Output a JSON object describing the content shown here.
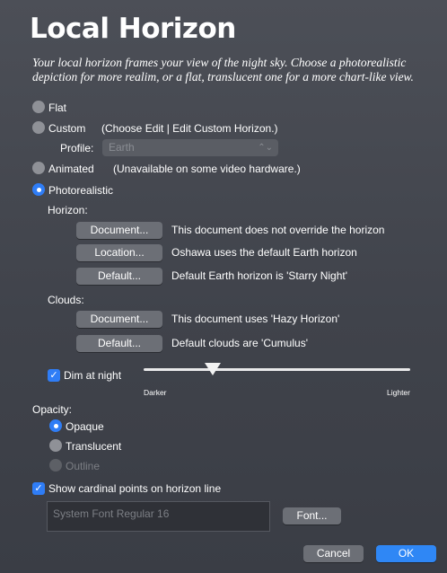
{
  "title": "Local Horizon",
  "subtitle": "Your local horizon frames your view of the night sky. Choose a photorealistic depiction for more realim, or a flat, translucent one for a more chart-like view.",
  "modes": {
    "flat": "Flat",
    "custom": "Custom",
    "custom_hint": "(Choose Edit | Edit Custom Horizon.)",
    "profile_label": "Profile:",
    "profile_value": "Earth",
    "animated": "Animated",
    "animated_hint": "(Unavailable on some video hardware.)",
    "photorealistic": "Photorealistic",
    "selected": "photorealistic"
  },
  "horizon": {
    "heading": "Horizon:",
    "rows": [
      {
        "button": "Document...",
        "text": "This document does not override the horizon"
      },
      {
        "button": "Location...",
        "text": "Oshawa uses the default Earth horizon"
      },
      {
        "button": "Default...",
        "text": "Default Earth horizon is 'Starry Night'"
      }
    ]
  },
  "clouds": {
    "heading": "Clouds:",
    "rows": [
      {
        "button": "Document...",
        "text": "This document uses 'Hazy Horizon'"
      },
      {
        "button": "Default...",
        "text": "Default clouds are 'Cumulus'"
      }
    ]
  },
  "dim": {
    "label": "Dim at night",
    "checked": true,
    "min_label": "Darker",
    "max_label": "Lighter",
    "level": 0.26
  },
  "opacity": {
    "heading": "Opacity:",
    "opaque": "Opaque",
    "translucent": "Translucent",
    "outline": "Outline",
    "selected": "opaque"
  },
  "cardinal": {
    "label": "Show cardinal points on horizon line",
    "checked": true,
    "font_value": "System Font Regular 16",
    "font_button": "Font..."
  },
  "footer": {
    "cancel": "Cancel",
    "ok": "OK"
  },
  "colors": {
    "accent": "#2f7df6",
    "background": "#40434b",
    "button": "#6c6f76"
  }
}
